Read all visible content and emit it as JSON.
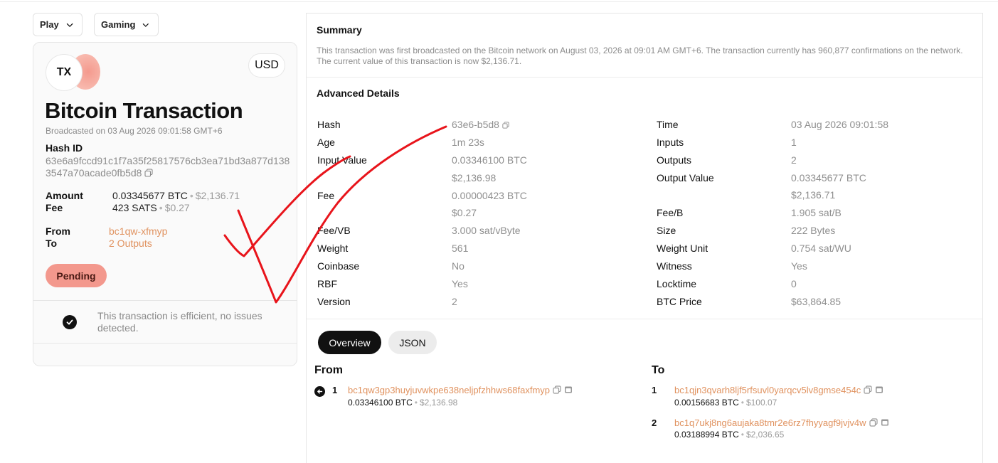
{
  "controls": {
    "play_label": "Play",
    "gaming_label": "Gaming"
  },
  "card": {
    "avatar_text": "TX",
    "currency": "USD",
    "title": "Bitcoin Transaction",
    "broadcasted": "Broadcasted on 03 Aug 2026 09:01:58 GMT+6",
    "hash_label": "Hash ID",
    "hash_value": "63e6a9fccd91c1f7a35f25817576cb3ea71bd3a877d1383547a70acade0fb5d8",
    "amount_label": "Amount",
    "amount_btc": "0.03345677 BTC",
    "amount_usd": "$2,136.71",
    "fee_label": "Fee",
    "fee_sats": "423 SATS",
    "fee_usd": "$0.27",
    "from_label": "From",
    "from_value": "bc1qw-xfmyp",
    "to_label": "To",
    "to_value": "2 Outputs",
    "status": "Pending",
    "efficiency_text": "This transaction is efficient, no issues detected."
  },
  "summary": {
    "title": "Summary",
    "text": "This transaction was first broadcasted on the Bitcoin network on August 03, 2026 at 09:01 AM GMT+6. The transaction currently has 960,877 confirmations on the network. The current value of this transaction is now $2,136.71."
  },
  "advanced": {
    "title": "Advanced Details",
    "left": [
      {
        "label": "Hash",
        "value": "63e6-b5d8"
      },
      {
        "label": "Age",
        "value": "1m 23s"
      },
      {
        "label": "Input Value",
        "value": "0.03346100 BTC"
      },
      {
        "label": "",
        "value": "$2,136.98"
      },
      {
        "label": "Fee",
        "value": "0.00000423 BTC"
      },
      {
        "label": "",
        "value": "$0.27"
      },
      {
        "label": "Fee/VB",
        "value": "3.000 sat/vByte"
      },
      {
        "label": "Weight",
        "value": "561"
      },
      {
        "label": "Coinbase",
        "value": "No"
      },
      {
        "label": "RBF",
        "value": "Yes"
      },
      {
        "label": "Version",
        "value": "2"
      }
    ],
    "right": [
      {
        "label": "Time",
        "value": "03 Aug 2026 09:01:58"
      },
      {
        "label": "Inputs",
        "value": "1"
      },
      {
        "label": "Outputs",
        "value": "2"
      },
      {
        "label": "Output Value",
        "value": "0.03345677 BTC"
      },
      {
        "label": "",
        "value": "$2,136.71"
      },
      {
        "label": "Fee/B",
        "value": "1.905 sat/B"
      },
      {
        "label": "Size",
        "value": "222 Bytes"
      },
      {
        "label": "Weight Unit",
        "value": "0.754 sat/WU"
      },
      {
        "label": "Witness",
        "value": "Yes"
      },
      {
        "label": "Locktime",
        "value": "0"
      },
      {
        "label": "BTC Price",
        "value": "$63,864.85"
      }
    ]
  },
  "tabs": {
    "overview": "Overview",
    "json": "JSON"
  },
  "io": {
    "from_title": "From",
    "to_title": "To",
    "inputs": [
      {
        "index": "1",
        "address": "bc1qw3gp3huyjuvwkpe638neljpfzhhws68faxfmyp",
        "btc": "0.03346100 BTC",
        "usd": "$2,136.98"
      }
    ],
    "outputs": [
      {
        "index": "1",
        "address": "bc1qjn3qvarh8ljf5rfsuvl0yarqcv5lv8gmse454c",
        "btc": "0.00156683 BTC",
        "usd": "$100.07"
      },
      {
        "index": "2",
        "address": "bc1q7ukj8ng6aujaka8tmr2e6rz7fhyyagf9jvjv4w",
        "btc": "0.03188994 BTC",
        "usd": "$2,036.65"
      }
    ]
  },
  "colors": {
    "accent_link": "#e0925f",
    "pending_bg": "#f3988d",
    "annotation_red": "#e8141b"
  }
}
